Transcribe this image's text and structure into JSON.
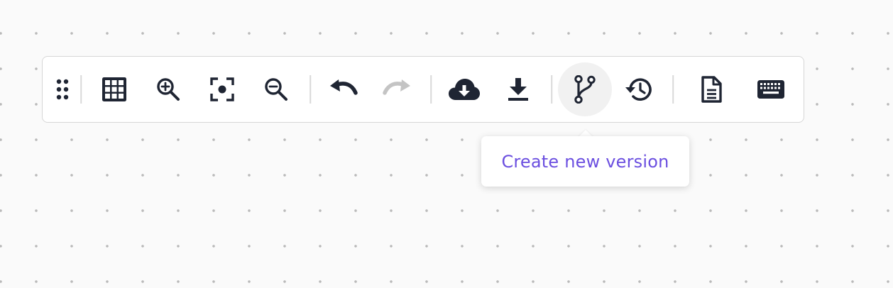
{
  "colors": {
    "icon": "#1f2533",
    "icon_disabled": "#c4c4c4",
    "tooltip_text": "#6b4fe0",
    "active_bg": "#f1f1f1"
  },
  "toolbar": {
    "items": [
      {
        "name": "drag-handle",
        "icon": "grip-dots-icon"
      },
      {
        "name": "toggle-grid-button",
        "icon": "grid-icon"
      },
      {
        "name": "zoom-in-button",
        "icon": "zoom-in-icon"
      },
      {
        "name": "fit-view-button",
        "icon": "focus-icon"
      },
      {
        "name": "zoom-out-button",
        "icon": "zoom-out-icon"
      },
      {
        "name": "undo-button",
        "icon": "undo-icon"
      },
      {
        "name": "redo-button",
        "icon": "redo-icon",
        "disabled": true
      },
      {
        "name": "cloud-download-button",
        "icon": "cloud-download-icon"
      },
      {
        "name": "download-button",
        "icon": "download-icon"
      },
      {
        "name": "create-version-button",
        "icon": "git-branch-icon",
        "active": true
      },
      {
        "name": "version-history-button",
        "icon": "history-icon"
      },
      {
        "name": "document-button",
        "icon": "document-icon"
      },
      {
        "name": "keyboard-shortcuts-button",
        "icon": "keyboard-icon"
      }
    ]
  },
  "tooltip": {
    "text": "Create new version"
  }
}
